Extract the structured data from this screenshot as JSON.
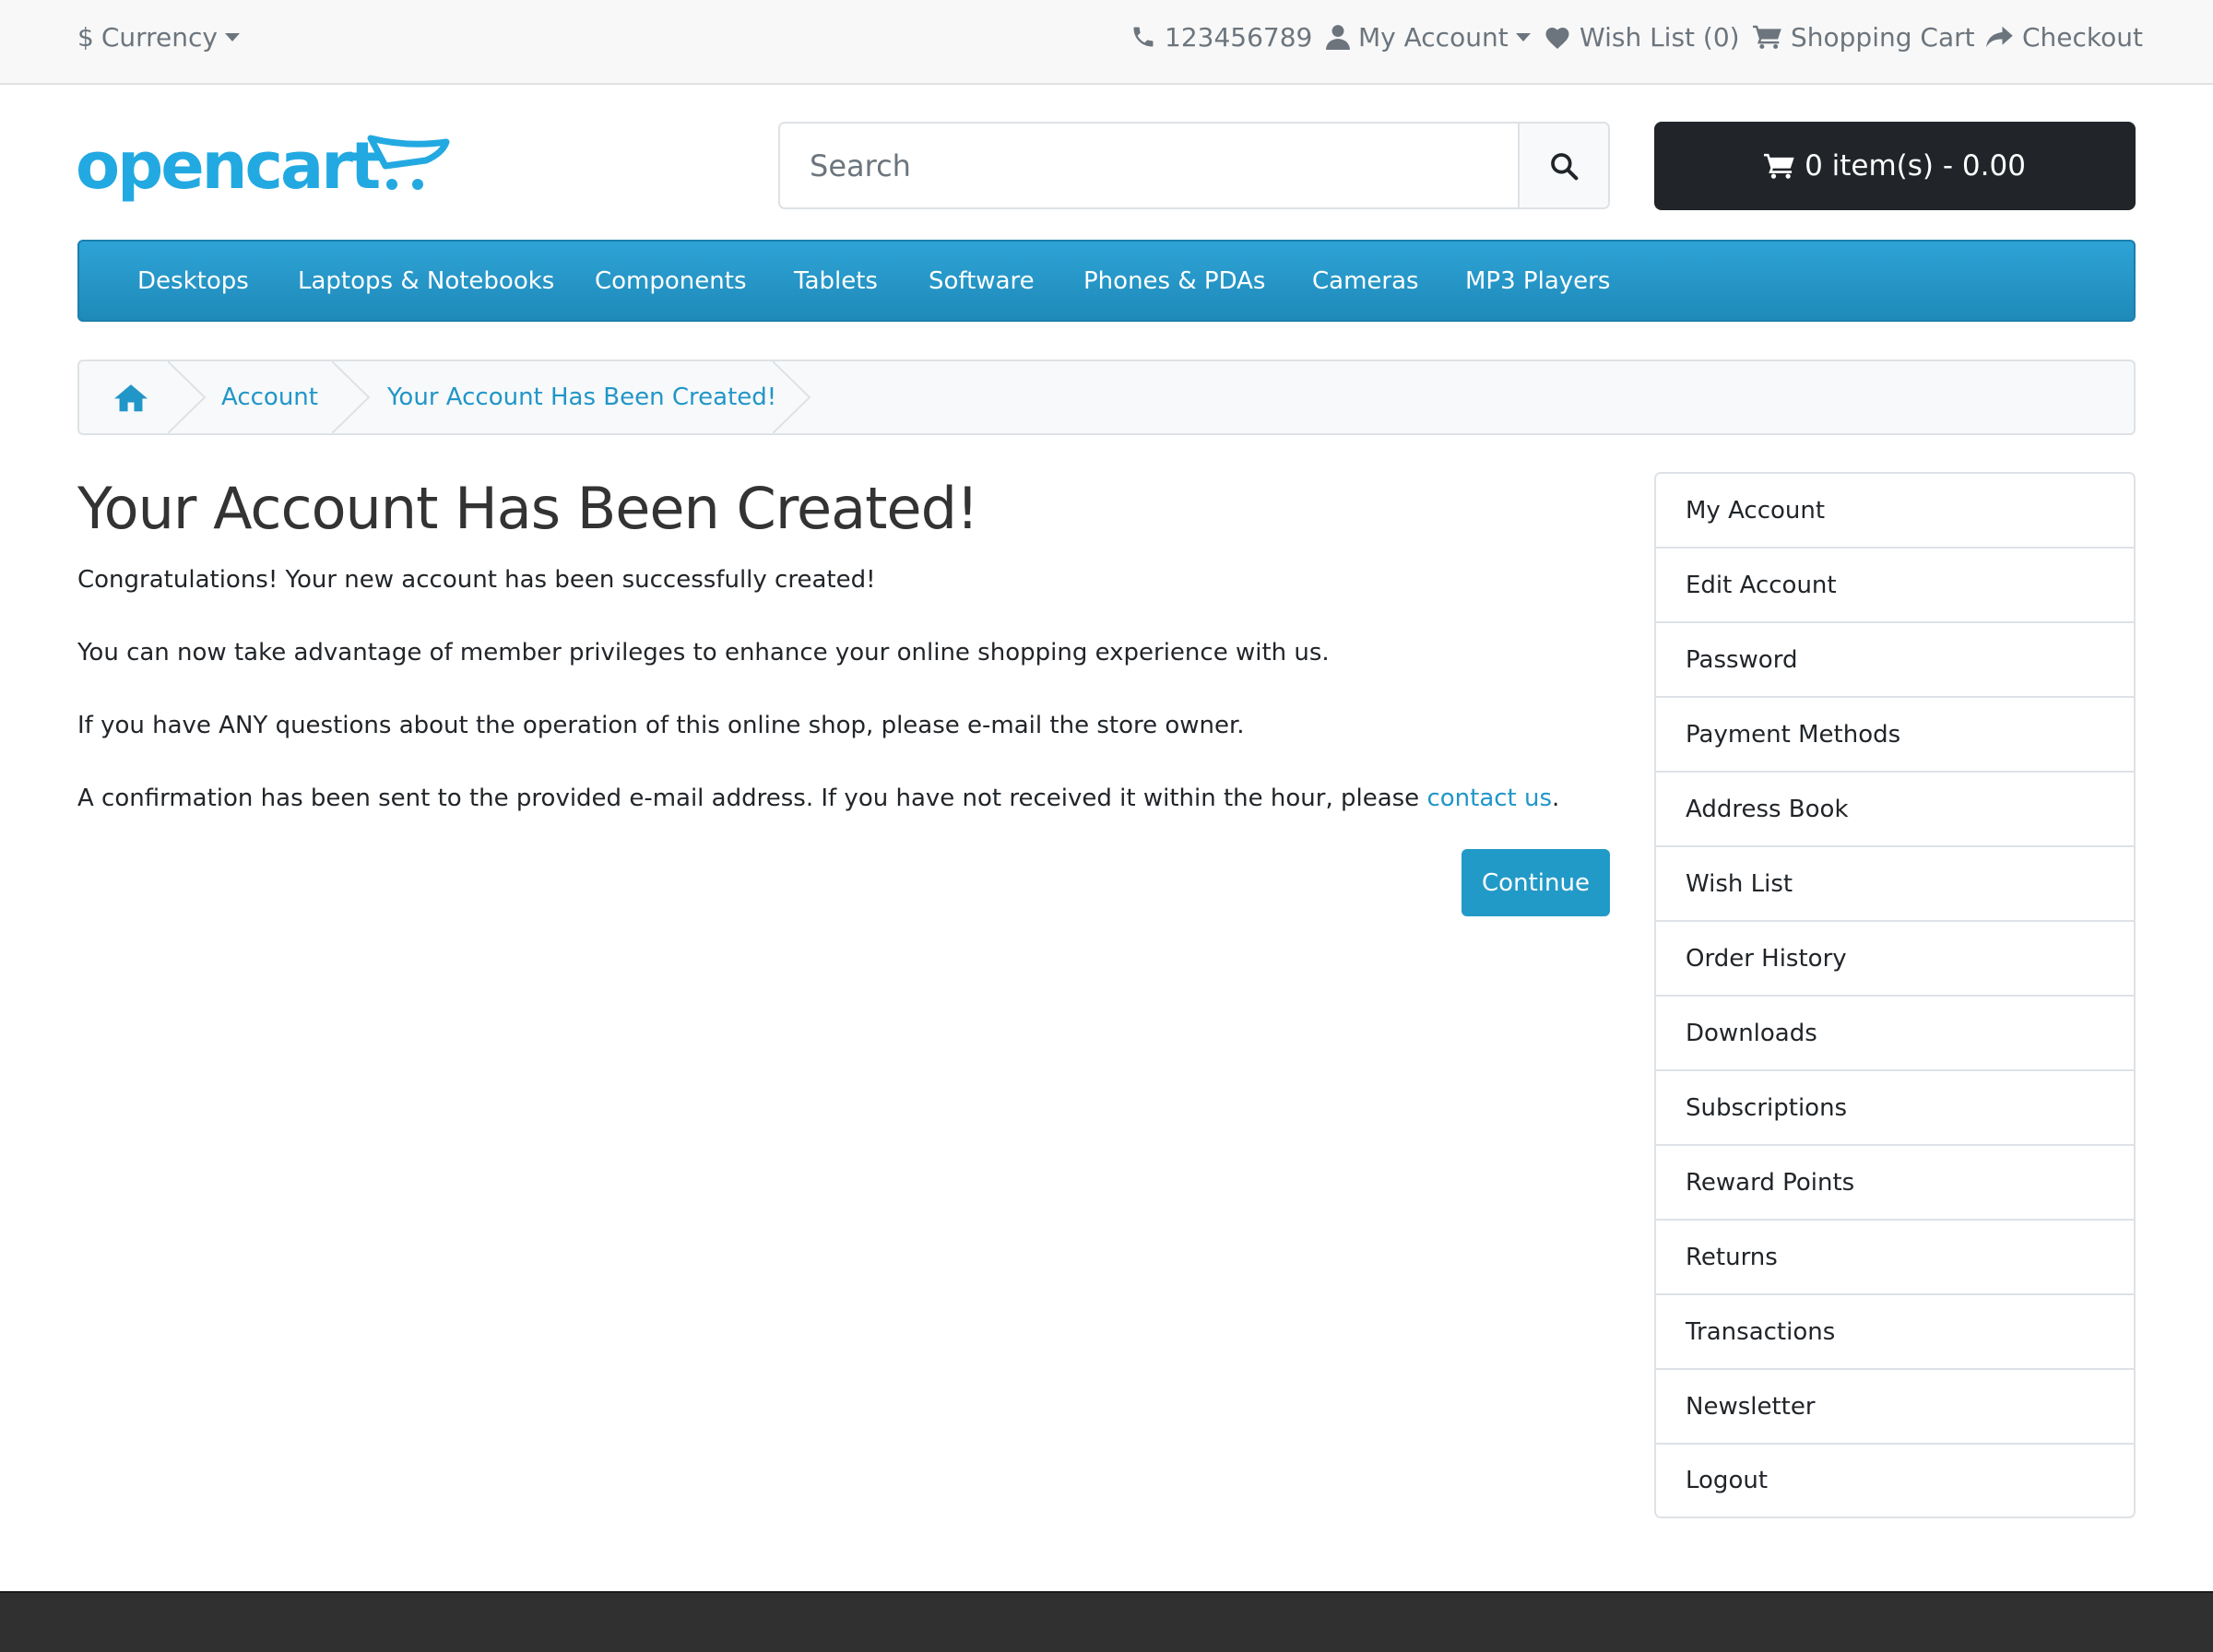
{
  "topbar": {
    "currency_label": "Currency",
    "currency_symbol": "$",
    "phone": "123456789",
    "my_account": "My Account",
    "wish_list": "Wish List (0)",
    "shopping_cart": "Shopping Cart",
    "checkout": "Checkout"
  },
  "header": {
    "logo_alt": "opencart",
    "search_placeholder": "Search",
    "cart_label": "0 item(s) - 0.00"
  },
  "nav": {
    "items": [
      "Desktops",
      "Laptops & Notebooks",
      "Components",
      "Tablets",
      "Software",
      "Phones & PDAs",
      "Cameras",
      "MP3 Players"
    ]
  },
  "breadcrumb": {
    "items": [
      "Account",
      "Your Account Has Been Created!"
    ]
  },
  "main": {
    "title": "Your Account Has Been Created!",
    "p1": "Congratulations! Your new account has been successfully created!",
    "p2": "You can now take advantage of member privileges to enhance your online shopping experience with us.",
    "p3": "If you have ANY questions about the operation of this online shop, please e-mail the store owner.",
    "p4_text": "A confirmation has been sent to the provided e-mail address. If you have not received it within the hour, please ",
    "p4_link": "contact us",
    "p4_end": ".",
    "continue_label": "Continue"
  },
  "sidebar": {
    "items": [
      "My Account",
      "Edit Account",
      "Password",
      "Payment Methods",
      "Address Book",
      "Wish List",
      "Order History",
      "Downloads",
      "Subscriptions",
      "Reward Points",
      "Returns",
      "Transactions",
      "Newsletter",
      "Logout"
    ]
  },
  "colors": {
    "accent": "#229ac8",
    "nav_top": "#2ea3d6",
    "cart_button": "#212529",
    "footer": "#303030"
  }
}
